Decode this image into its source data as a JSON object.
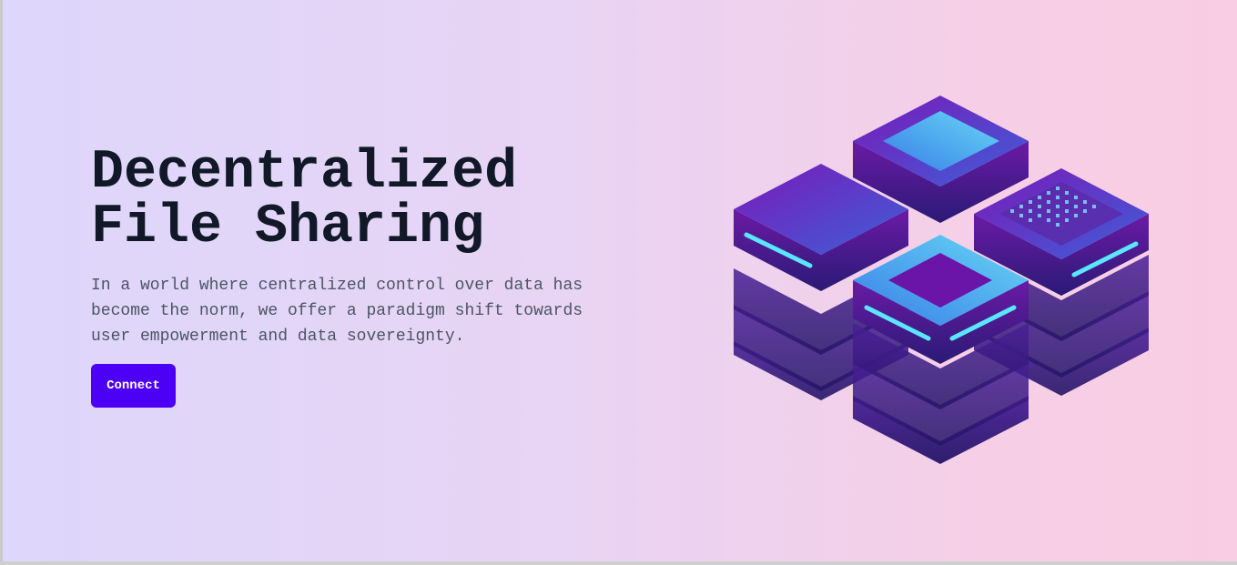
{
  "hero": {
    "title_line1": "Decentralized",
    "title_line2": "File Sharing",
    "description": "In a world where centralized control over data has become the norm, we offer a paradigm shift towards user empowerment and data sovereignty.",
    "cta_label": "Connect"
  },
  "illustration": {
    "icon": "server-stack-illustration"
  },
  "colors": {
    "accent": "#4c00f5",
    "title": "#111827",
    "body_text": "#4b5563",
    "bg_left": "#ddd7fb",
    "bg_right": "#f9cde3"
  }
}
